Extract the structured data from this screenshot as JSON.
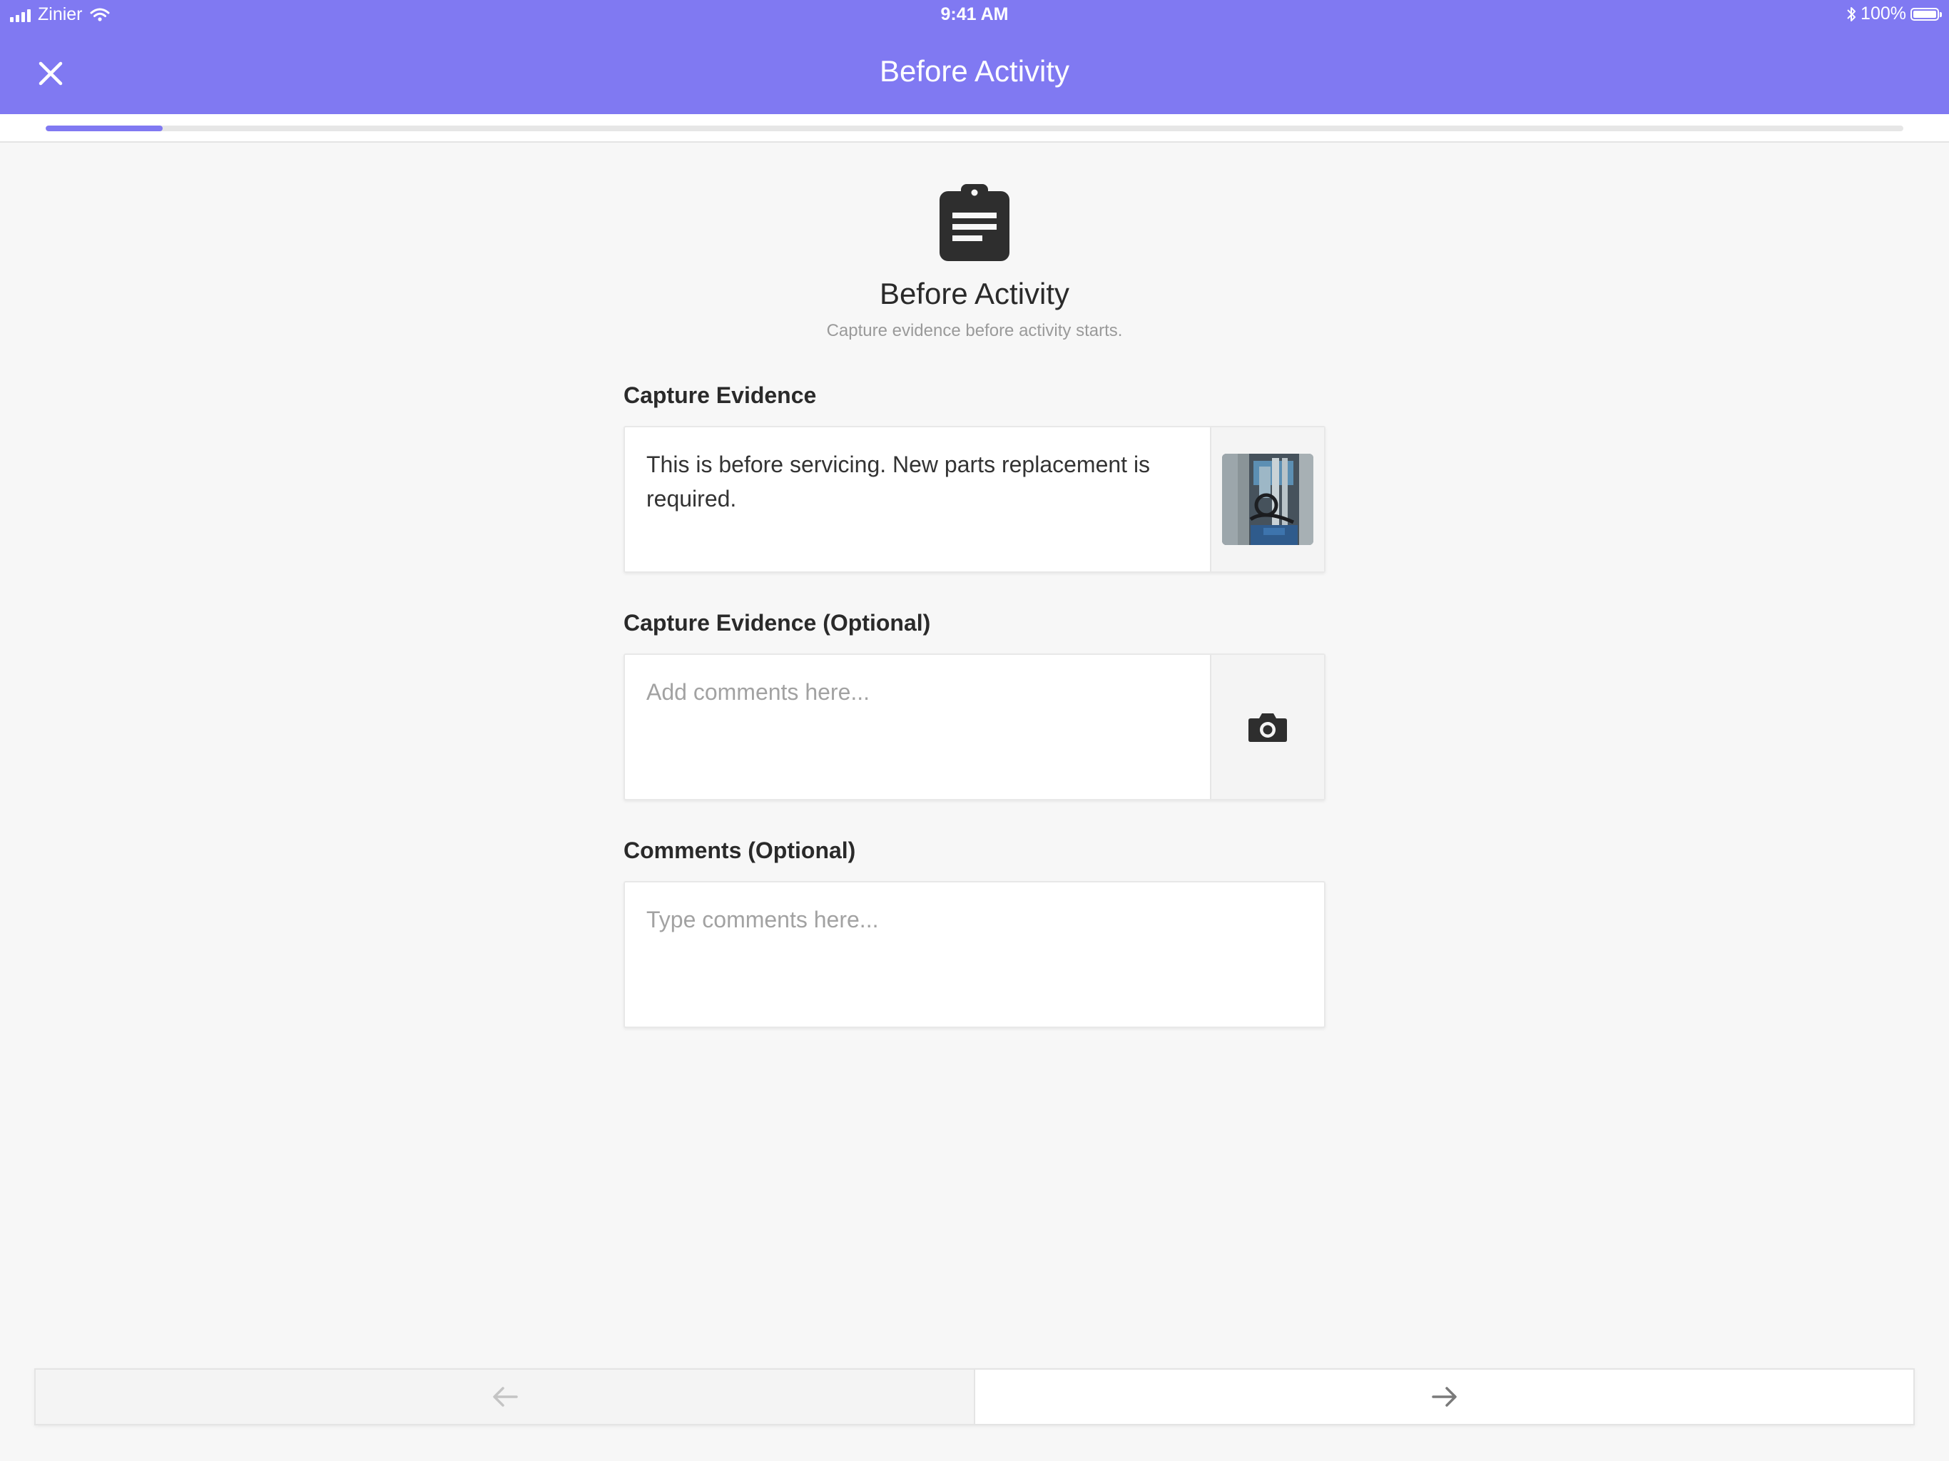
{
  "status_bar": {
    "carrier": "Zinier",
    "time": "9:41 AM",
    "battery": "100%"
  },
  "header": {
    "title": "Before Activity",
    "close_icon": "close-icon"
  },
  "progress": {
    "fraction": 0.063
  },
  "section": {
    "icon": "clipboard-icon",
    "title": "Before Activity",
    "subtitle": "Capture evidence before activity starts."
  },
  "fields": {
    "capture_evidence": {
      "label": "Capture Evidence",
      "value": "This is before servicing. New parts replacement is required.",
      "media": "photo-thumbnail"
    },
    "capture_evidence_optional": {
      "label": "Capture Evidence (Optional)",
      "placeholder": "Add comments here...",
      "media_icon": "camera-icon"
    },
    "comments_optional": {
      "label": "Comments (Optional)",
      "placeholder": "Type comments here..."
    }
  },
  "footer": {
    "prev_icon": "arrow-left-icon",
    "next_icon": "arrow-right-icon"
  },
  "colors": {
    "accent": "#8079f2",
    "background": "#f7f7f7"
  }
}
